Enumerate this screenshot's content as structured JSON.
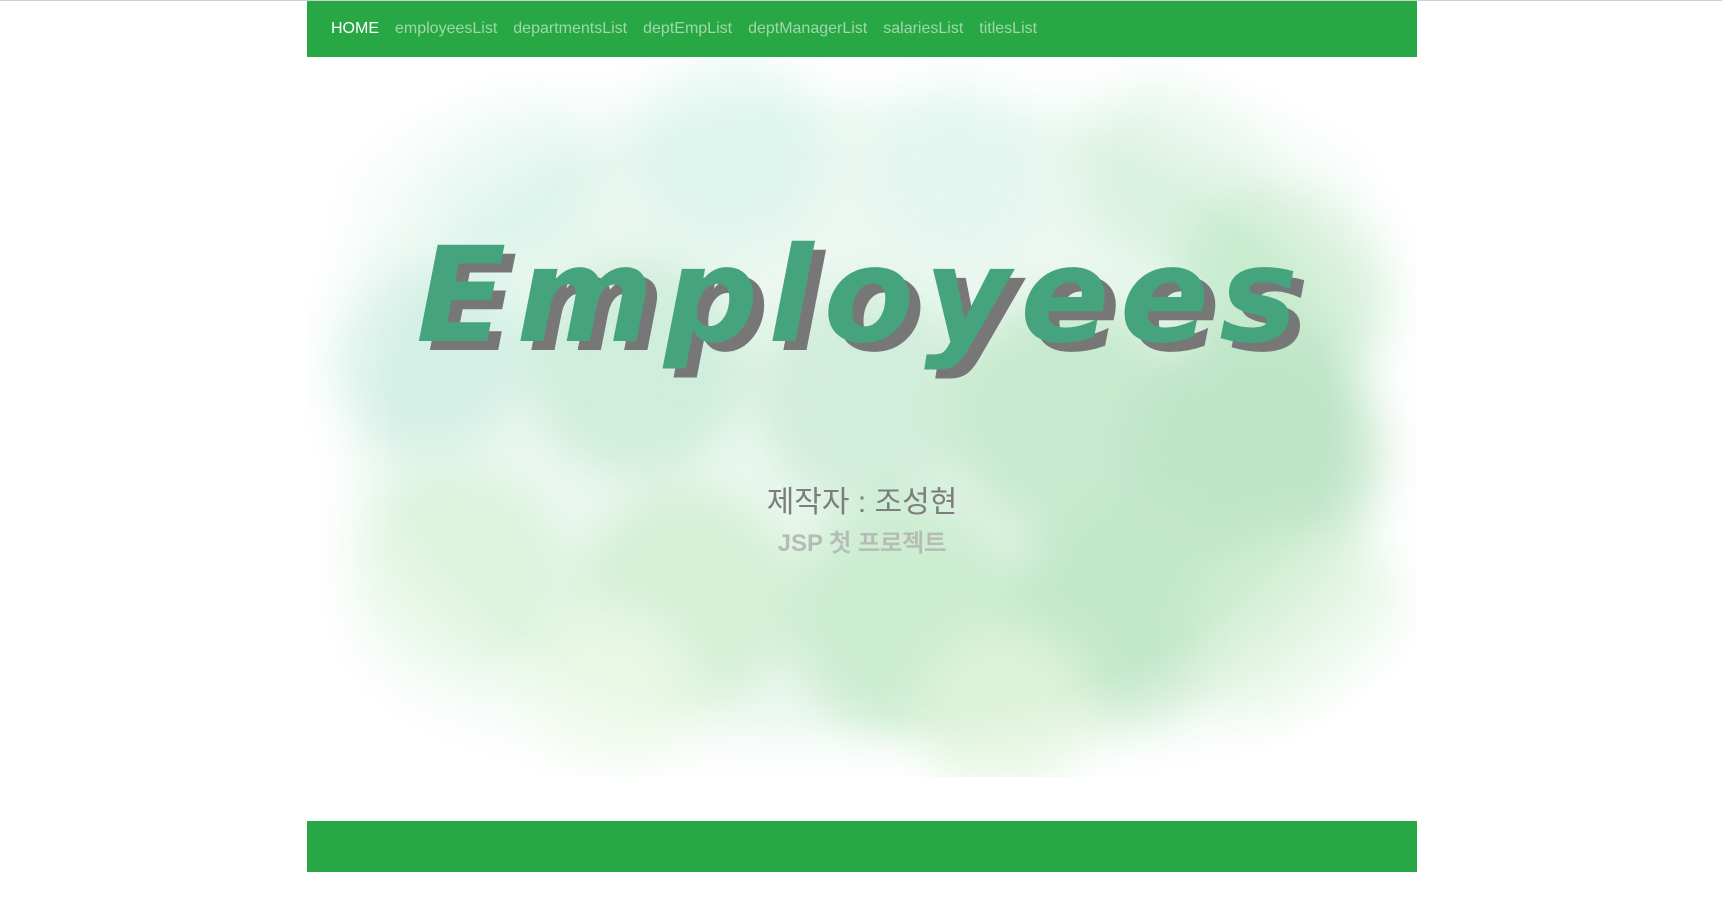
{
  "nav": {
    "items": [
      {
        "label": "HOME",
        "active": true
      },
      {
        "label": "employeesList",
        "active": false
      },
      {
        "label": "departmentsList",
        "active": false
      },
      {
        "label": "deptEmpList",
        "active": false
      },
      {
        "label": "deptManagerList",
        "active": false
      },
      {
        "label": "salariesList",
        "active": false
      },
      {
        "label": "titlesList",
        "active": false
      }
    ]
  },
  "hero": {
    "title": "Employees",
    "author": "제작자 : 조성현",
    "subtitle": "JSP 첫 프로젝트"
  },
  "colors": {
    "brand_green": "#28a745",
    "title_green": "#45a47d",
    "title_shadow": "#777777"
  }
}
